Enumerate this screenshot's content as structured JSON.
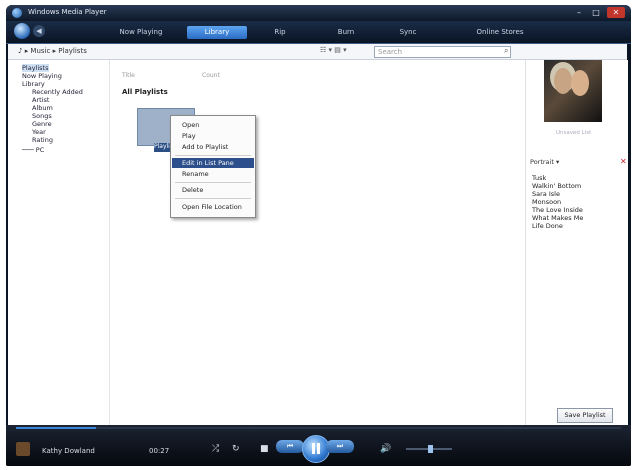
{
  "window": {
    "title": "Windows Media Player",
    "buttons": {
      "minimize": "–",
      "maximize": "□",
      "close": "✕"
    }
  },
  "nav": {
    "back": "◀",
    "tabs": [
      {
        "label": "Now Playing"
      },
      {
        "label": "Library"
      },
      {
        "label": "Rip"
      },
      {
        "label": "Burn"
      },
      {
        "label": "Sync"
      },
      {
        "label": "Online Stores"
      }
    ],
    "active_tab": "Library"
  },
  "toolbar": {
    "breadcrumb": "♪ ▸ Music ▸ Playlists",
    "view_options": "☷ ▾ ▤ ▾",
    "search_placeholder": "Search",
    "search_icon": "search-icon"
  },
  "navpane": {
    "items": [
      {
        "label": "Playlists"
      },
      {
        "label": "Now Playing"
      },
      {
        "label": "Library"
      },
      {
        "label": "Recently Added"
      },
      {
        "label": "Artist"
      },
      {
        "label": "Album"
      },
      {
        "label": "Songs"
      },
      {
        "label": "Genre"
      },
      {
        "label": "Year"
      },
      {
        "label": "Rating"
      },
      {
        "label": "─── PC"
      }
    ]
  },
  "content": {
    "col_title": "Title",
    "col_count": "Count",
    "heading": "All Playlists",
    "playlist_label": "Playlist"
  },
  "context_menu": {
    "items": [
      {
        "label": "Open"
      },
      {
        "label": "Play"
      },
      {
        "label": "Add to Playlist"
      },
      {
        "label": "Edit in List Pane"
      },
      {
        "label": "Rename"
      },
      {
        "label": "Delete"
      },
      {
        "label": "Open File Location"
      }
    ],
    "highlighted": "Edit in List Pane"
  },
  "listpane": {
    "album_caption": "Unsaved List",
    "header": "Portrait ▾",
    "close": "✕",
    "songs": [
      {
        "label": "Tusk"
      },
      {
        "label": "Walkin' Bottom"
      },
      {
        "label": "Sara Isle"
      },
      {
        "label": "Monsoon"
      },
      {
        "label": "The Love Inside"
      },
      {
        "label": "What Makes Me"
      },
      {
        "label": "Life Done"
      }
    ],
    "save_label": "Save Playlist"
  },
  "player": {
    "now_playing": "Kathy Dowland",
    "time": "00:27",
    "shuffle": "⤮",
    "repeat": "↻",
    "stop": "■",
    "prev": "⏮",
    "next": "⏭",
    "mute": "🔊",
    "accent": "#2f79d2"
  }
}
